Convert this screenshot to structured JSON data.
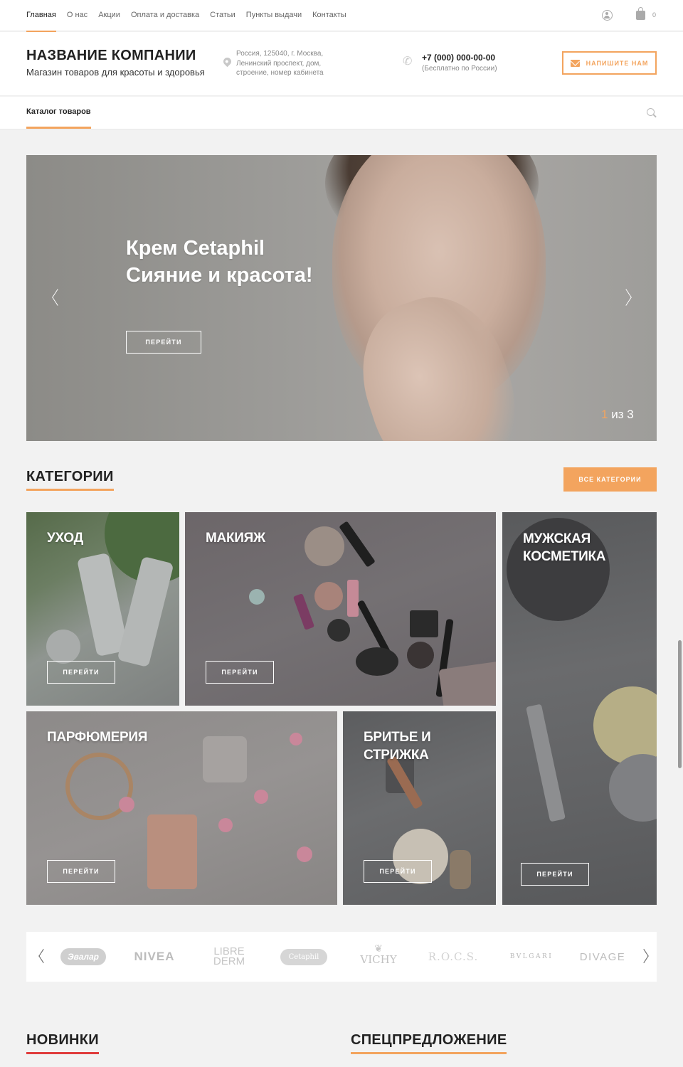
{
  "topnav": {
    "items": [
      {
        "label": "Главная"
      },
      {
        "label": "О нас"
      },
      {
        "label": "Акции"
      },
      {
        "label": "Оплата и доставка"
      },
      {
        "label": "Статьи"
      },
      {
        "label": "Пункты выдачи"
      },
      {
        "label": "Контакты"
      }
    ],
    "cart_count": "0"
  },
  "header": {
    "company": "НАЗВАНИЕ КОМПАНИИ",
    "tagline": "Магазин товаров для красоты и здоровья",
    "address_lines": [
      "Россия, 125040, г. Москва,",
      "Ленинский проспект, дом,",
      "строение, номер кабинета"
    ],
    "phone": "+7 (000) 000-00-00",
    "phone_note": "(Бесплатно по России)",
    "write_label": "НАПИШИТЕ НАМ"
  },
  "catalog": {
    "label": "Каталог товаров"
  },
  "hero": {
    "title_line1": "Крем Cetaphil",
    "title_line2": "Сияние и красота!",
    "button": "ПЕРЕЙТИ",
    "current": "1",
    "total_text": "из 3"
  },
  "categories": {
    "title": "КАТЕГОРИИ",
    "all_button": "ВСЕ КАТЕГОРИИ",
    "items": [
      {
        "title_lines": [
          "УХОД"
        ],
        "button": "ПЕРЕЙТИ"
      },
      {
        "title_lines": [
          "МАКИЯЖ"
        ],
        "button": "ПЕРЕЙТИ"
      },
      {
        "title_lines": [
          "МУЖСКАЯ",
          "КОСМЕТИКА"
        ],
        "button": "ПЕРЕЙТИ"
      },
      {
        "title_lines": [
          "ПАРФЮМЕРИЯ"
        ],
        "button": "ПЕРЕЙТИ"
      },
      {
        "title_lines": [
          "БРИТЬЕ И",
          "СТРИЖКА"
        ],
        "button": "ПЕРЕЙТИ"
      }
    ]
  },
  "brands": {
    "items": [
      "Эвалар",
      "NIVEA",
      "LIBRE",
      "DERM",
      "Cetaphil",
      "VICHY",
      "R.O.C.S.",
      "BVLGARI",
      "DIVAGE"
    ]
  },
  "sections": {
    "new_title": "НОВИНКИ",
    "special_title": "СПЕЦПРЕДЛОЖЕНИЕ"
  },
  "colors": {
    "accent": "#f3a45e",
    "new_underline": "#e03c3c"
  }
}
